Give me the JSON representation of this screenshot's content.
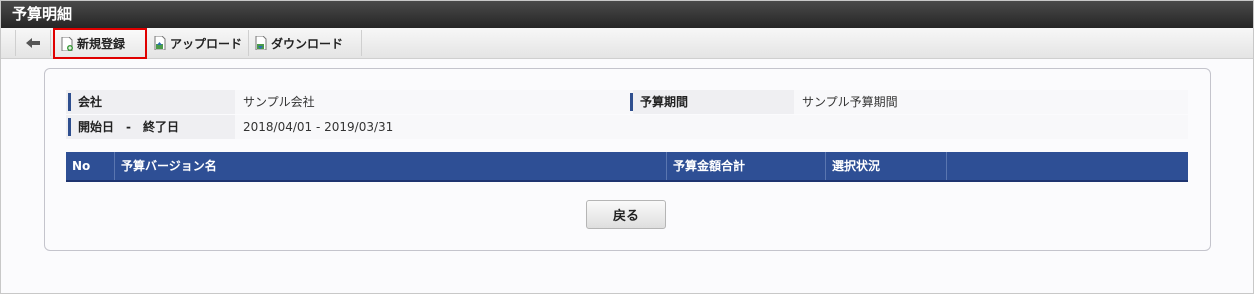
{
  "window": {
    "title": "予算明細"
  },
  "toolbar": {
    "new_label": "新規登録",
    "upload_label": "アップロード",
    "download_label": "ダウンロード"
  },
  "info": {
    "company_label": "会社",
    "company_value": "サンプル会社",
    "period_label": "予算期間",
    "period_value": "サンプル予算期間",
    "range_label": "開始日　-　終了日",
    "range_value": "2018/04/01 - 2019/03/31"
  },
  "table": {
    "headers": [
      "No",
      "予算バージョン名",
      "予算金額合計",
      "選択状況",
      ""
    ]
  },
  "footer": {
    "back_label": "戻る"
  },
  "colors": {
    "header_blue": "#2e4f95",
    "accent_red": "#e00000",
    "titlebar": "#333333"
  }
}
